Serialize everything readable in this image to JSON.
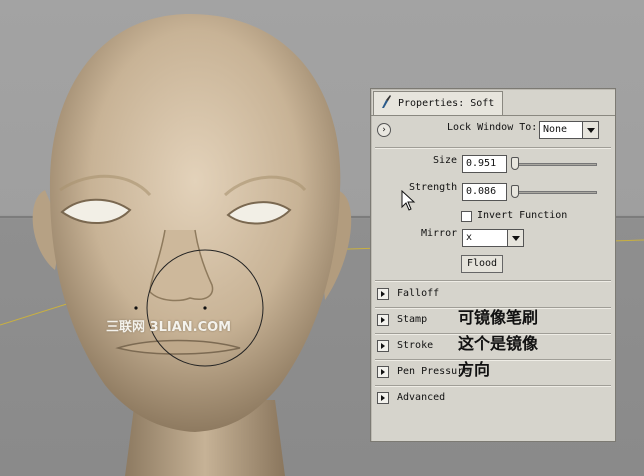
{
  "panel": {
    "tab_title": "Properties: Soft",
    "lock_window_label": "Lock Window To:",
    "lock_window_value": "None",
    "size_label": "Size",
    "size_value": "0.951",
    "strength_label": "Strength",
    "strength_value": "0.086",
    "invert_label": "Invert Function",
    "mirror_label": "Mirror",
    "mirror_value": "x",
    "flood_label": "Flood",
    "sections": [
      "Falloff",
      "Stamp",
      "Stroke",
      "Pen Pressure",
      "Advanced"
    ]
  },
  "annotation": {
    "line1": "可镜像笔刷",
    "line2": "这个是镜像",
    "line3": "方向"
  },
  "watermark": "三联网 3LIAN.COM",
  "colors": {
    "viewport_bg": "#9f9f9f",
    "skin": "#c9b59b",
    "panel_bg": "#d6d4cc"
  },
  "icons": [
    "brush-icon",
    "expand-circle-icon",
    "mouse-cursor-icon",
    "chevron-down-icon",
    "triangle-right-icon"
  ]
}
